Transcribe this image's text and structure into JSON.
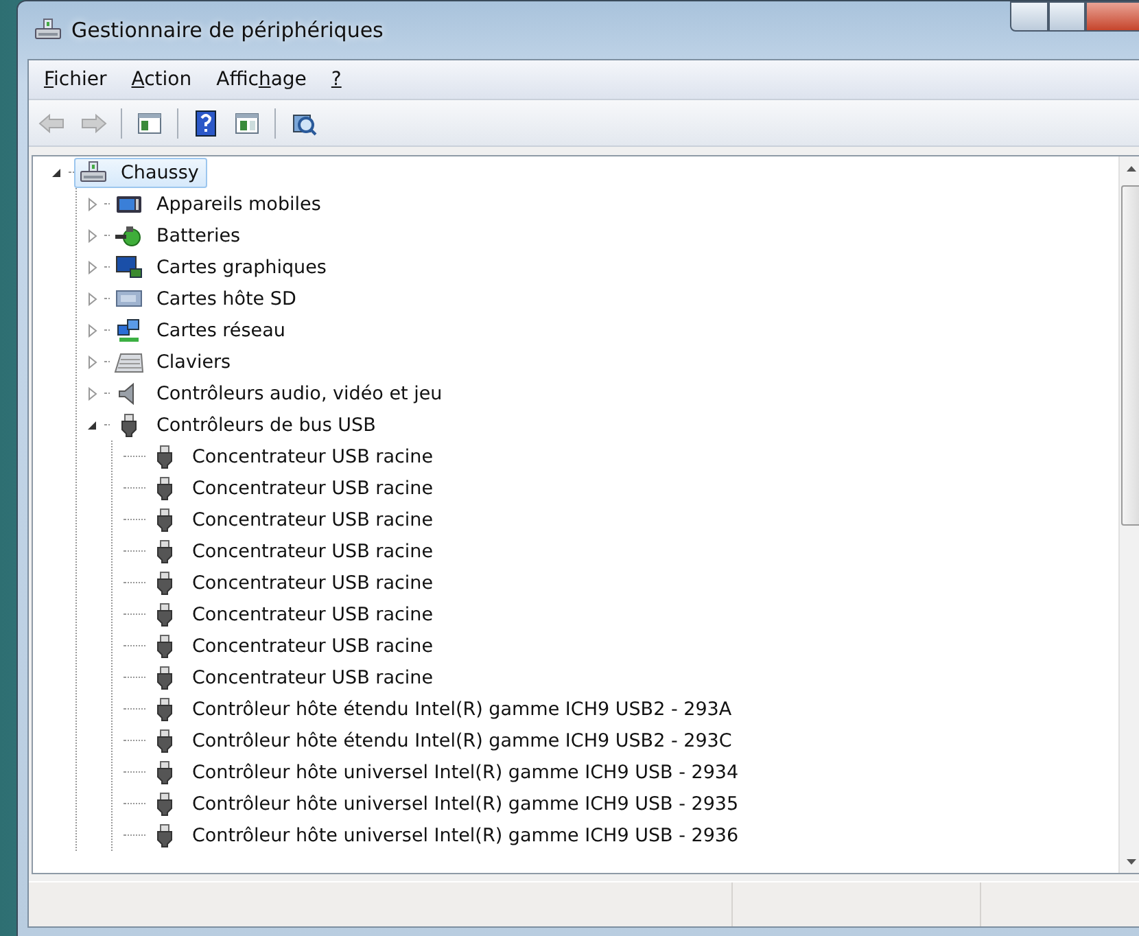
{
  "window": {
    "title": "Gestionnaire de périphériques"
  },
  "menu": [
    {
      "key": "F",
      "after": "ichier"
    },
    {
      "key": "A",
      "after": "ction"
    },
    {
      "before": "Affic",
      "key": "h",
      "after": "age"
    },
    {
      "key": "?"
    }
  ],
  "toolbar": [
    [
      {
        "kind": "back",
        "disabled": true
      },
      {
        "kind": "forward",
        "disabled": true
      }
    ],
    [
      {
        "kind": "console",
        "disabled": false
      }
    ],
    [
      {
        "kind": "help",
        "disabled": false
      },
      {
        "kind": "pane",
        "disabled": false
      }
    ],
    [
      {
        "kind": "scan",
        "disabled": false
      }
    ]
  ],
  "tree": {
    "label": "Chaussy",
    "kind": "computer",
    "expanded": true,
    "selected": true,
    "children": [
      {
        "label": "Appareils mobiles",
        "kind": "mobile",
        "expanded": false,
        "selected": false
      },
      {
        "label": "Batteries",
        "kind": "battery",
        "expanded": false,
        "selected": false
      },
      {
        "label": "Cartes graphiques",
        "kind": "display",
        "expanded": false,
        "selected": false
      },
      {
        "label": "Cartes hôte SD",
        "kind": "sd",
        "expanded": false,
        "selected": false
      },
      {
        "label": "Cartes réseau",
        "kind": "network",
        "expanded": false,
        "selected": false
      },
      {
        "label": "Claviers",
        "kind": "keyboard",
        "expanded": false,
        "selected": false
      },
      {
        "label": "Contrôleurs audio, vidéo et jeu",
        "kind": "audio",
        "expanded": false,
        "selected": false
      },
      {
        "label": "Contrôleurs de bus USB",
        "kind": "usb",
        "expanded": true,
        "selected": false,
        "children": [
          {
            "label": "Concentrateur USB racine",
            "kind": "usb",
            "selected": false
          },
          {
            "label": "Concentrateur USB racine",
            "kind": "usb",
            "selected": false
          },
          {
            "label": "Concentrateur USB racine",
            "kind": "usb",
            "selected": false
          },
          {
            "label": "Concentrateur USB racine",
            "kind": "usb",
            "selected": false
          },
          {
            "label": "Concentrateur USB racine",
            "kind": "usb",
            "selected": false
          },
          {
            "label": "Concentrateur USB racine",
            "kind": "usb",
            "selected": false
          },
          {
            "label": "Concentrateur USB racine",
            "kind": "usb",
            "selected": false
          },
          {
            "label": "Concentrateur USB racine",
            "kind": "usb",
            "selected": false
          },
          {
            "label": "Contrôleur hôte étendu Intel(R) gamme ICH9 USB2 - 293A",
            "kind": "usb",
            "selected": false
          },
          {
            "label": "Contrôleur hôte étendu Intel(R) gamme ICH9 USB2 - 293C",
            "kind": "usb",
            "selected": false
          },
          {
            "label": "Contrôleur hôte universel Intel(R) gamme ICH9 USB - 2934",
            "kind": "usb",
            "selected": false
          },
          {
            "label": "Contrôleur hôte universel Intel(R) gamme ICH9 USB - 2935",
            "kind": "usb",
            "selected": false
          },
          {
            "label": "Contrôleur hôte universel Intel(R) gamme ICH9 USB - 2936",
            "kind": "usb",
            "selected": false
          }
        ]
      }
    ]
  }
}
